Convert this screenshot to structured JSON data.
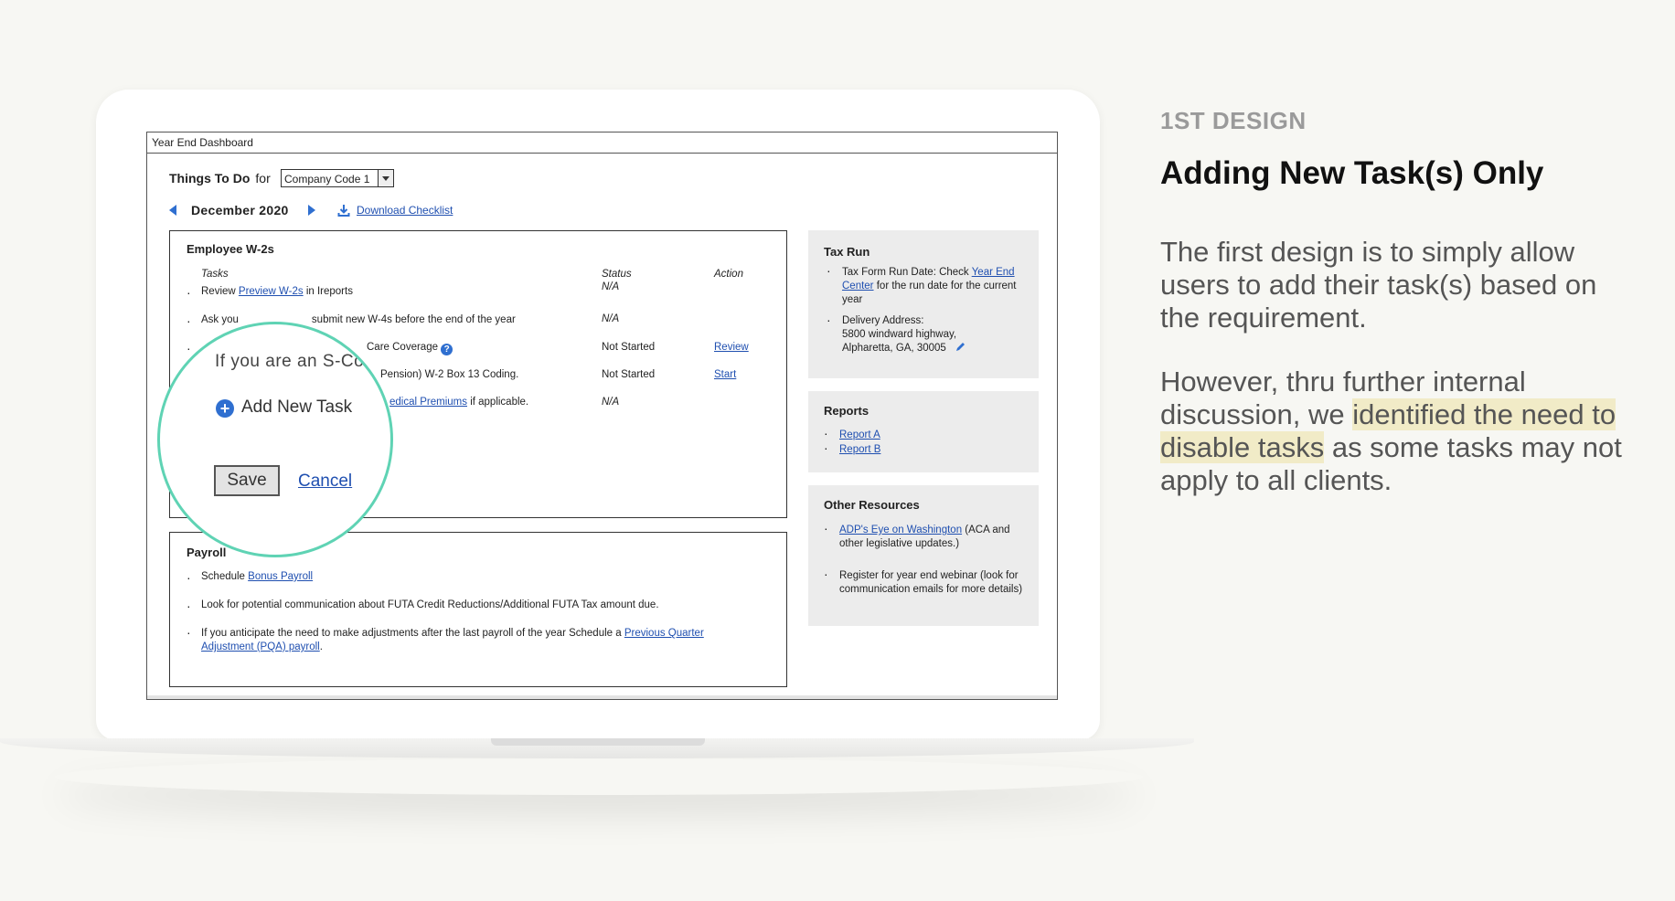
{
  "side_text": {
    "kicker": "1ST DESIGN",
    "title": "Adding New Task(s) Only",
    "p1": "The first design is to simply allow users to add their task(s) based on the requirement.",
    "p2_pre": "However, thru further internal discussion, we ",
    "p2_highlight": "identified the need to disable tasks",
    "p2_post": " as some tasks may not apply to all clients."
  },
  "window": {
    "title": "Year End Dashboard"
  },
  "header": {
    "things_to_do": "Things To Do",
    "for": "for",
    "company_select": "Company Code 1",
    "month": "December 2020",
    "download": "Download Checklist"
  },
  "w2": {
    "title": "Employee W-2s",
    "col_tasks": "Tasks",
    "col_status": "Status",
    "col_action": "Action",
    "r1_pre": "Review ",
    "r1_link": "Preview W-2s",
    "r1_post": " in Ireports",
    "r1_status": "N/A",
    "r2_pre": "Ask you",
    "r2_post": "submit new W-4s before the end of the year",
    "r2_status": "N/A",
    "r3_text": "Care Coverage",
    "r3_status": "Not Started",
    "r3_action": "Review",
    "r4_text": "Pension) W-2 Box 13 Coding.",
    "r4_status": "Not Started",
    "r4_action": "Start",
    "r5_link": "edical Premiums",
    "r5_post": " if applicable.",
    "r5_status": "N/A"
  },
  "payroll": {
    "title": "Payroll",
    "r1_pre": "Schedule ",
    "r1_link": "Bonus Payroll",
    "r2": "Look for potential communication about FUTA Credit Reductions/Additional FUTA Tax amount due.",
    "r3_pre": "If you anticipate the need to make adjustments after the last payroll of the year Schedule a ",
    "r3_link": "Previous Quarter Adjustment (PQA) payroll",
    "r3_post": "."
  },
  "tax_run": {
    "title": "Tax Run",
    "b1_pre": "Tax Form Run Date: Check ",
    "b1_link": "Year End Center",
    "b1_post": " for the run date for the current year",
    "b2_label": "Delivery Address:",
    "b2_line1": "5800 windward highway,",
    "b2_line2": "Alpharetta, GA, 30005"
  },
  "reports": {
    "title": "Reports",
    "a": "Report A",
    "b": "Report B"
  },
  "other": {
    "title": "Other Resources",
    "b1_link": "ADP's Eye on Washington",
    "b1_post": " (ACA and other legislative updates.)",
    "b2": "Register for year end webinar (look for communication emails for more details)"
  },
  "magnifier": {
    "text": "If you are an S-Co",
    "add_task": "Add New Task",
    "save": "Save",
    "cancel": "Cancel"
  },
  "icons": {
    "help": "help-circle-icon",
    "edit": "pencil-icon",
    "add": "plus-circle-icon",
    "download": "download-icon"
  },
  "colors": {
    "accent": "#2f6fd0",
    "link": "#1f4fb0",
    "magnifier_ring": "#5fd3b4",
    "highlight": "#f1ebc7"
  }
}
